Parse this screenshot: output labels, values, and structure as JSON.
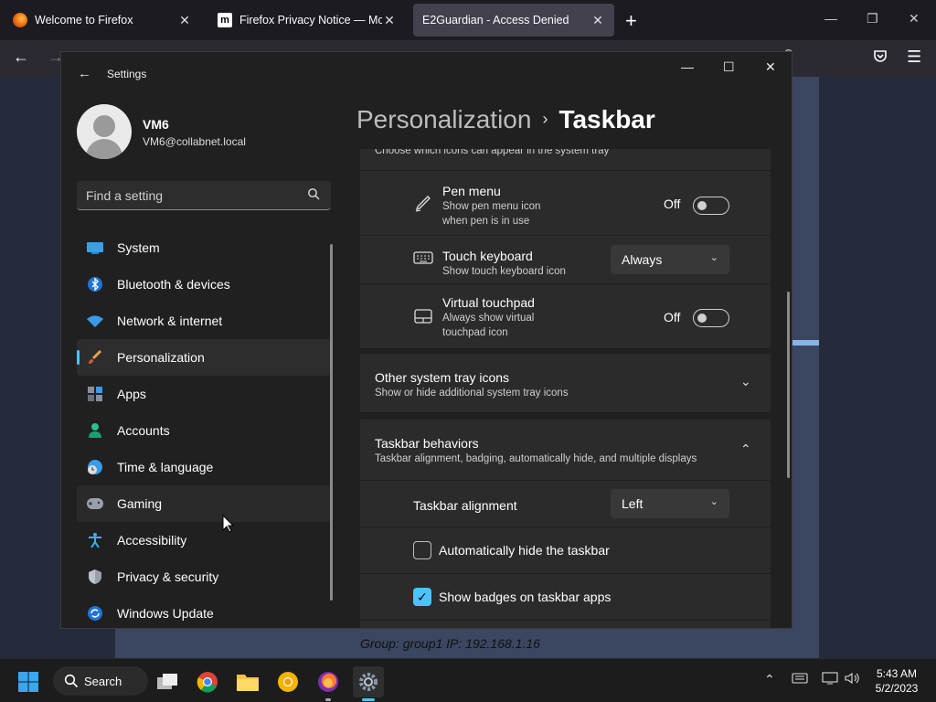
{
  "browser": {
    "tabs": [
      {
        "title": "Welcome to Firefox",
        "active": false
      },
      {
        "title": "Firefox Privacy Notice — Mozilla",
        "active": false
      },
      {
        "title": "E2Guardian - Access Denied",
        "active": true
      }
    ]
  },
  "page": {
    "footer": "Group: group1   IP: 192.168.1.16"
  },
  "settings": {
    "window_title": "Settings",
    "profile": {
      "name": "VM6",
      "email": "VM6@collabnet.local"
    },
    "search_placeholder": "Find a setting",
    "nav": [
      {
        "label": "System",
        "icon": "monitor-icon"
      },
      {
        "label": "Bluetooth & devices",
        "icon": "bluetooth-icon"
      },
      {
        "label": "Network & internet",
        "icon": "wifi-icon"
      },
      {
        "label": "Personalization",
        "icon": "brush-icon",
        "selected": true
      },
      {
        "label": "Apps",
        "icon": "apps-icon"
      },
      {
        "label": "Accounts",
        "icon": "person-icon"
      },
      {
        "label": "Time & language",
        "icon": "clock-globe-icon"
      },
      {
        "label": "Gaming",
        "icon": "gamepad-icon"
      },
      {
        "label": "Accessibility",
        "icon": "accessibility-icon"
      },
      {
        "label": "Privacy & security",
        "icon": "shield-icon"
      },
      {
        "label": "Windows Update",
        "icon": "update-icon"
      }
    ],
    "breadcrumb": {
      "parent": "Personalization",
      "separator": "›",
      "current": "Taskbar"
    },
    "content": {
      "partial_header": "Choose which icons can appear in the system tray",
      "pen_menu": {
        "title": "Pen menu",
        "sub": "Show pen menu icon when pen is in use",
        "state": "Off"
      },
      "touch_keyboard": {
        "title": "Touch keyboard",
        "sub": "Show touch keyboard icon",
        "value": "Always"
      },
      "virtual_touchpad": {
        "title": "Virtual touchpad",
        "sub": "Always show virtual touchpad icon",
        "state": "Off"
      },
      "other_tray": {
        "title": "Other system tray icons",
        "sub": "Show or hide additional system tray icons"
      },
      "behaviors": {
        "title": "Taskbar behaviors",
        "sub": "Taskbar alignment, badging, automatically hide, and multiple displays"
      },
      "alignment": {
        "label": "Taskbar alignment",
        "value": "Left"
      },
      "auto_hide": {
        "label": "Automatically hide the taskbar",
        "checked": false
      },
      "badges": {
        "label": "Show badges on taskbar apps",
        "checked": true
      }
    }
  },
  "taskbar": {
    "search_label": "Search",
    "time": "5:43 AM",
    "date": "5/2/2023"
  },
  "colors": {
    "accent": "#4cc2ff"
  }
}
